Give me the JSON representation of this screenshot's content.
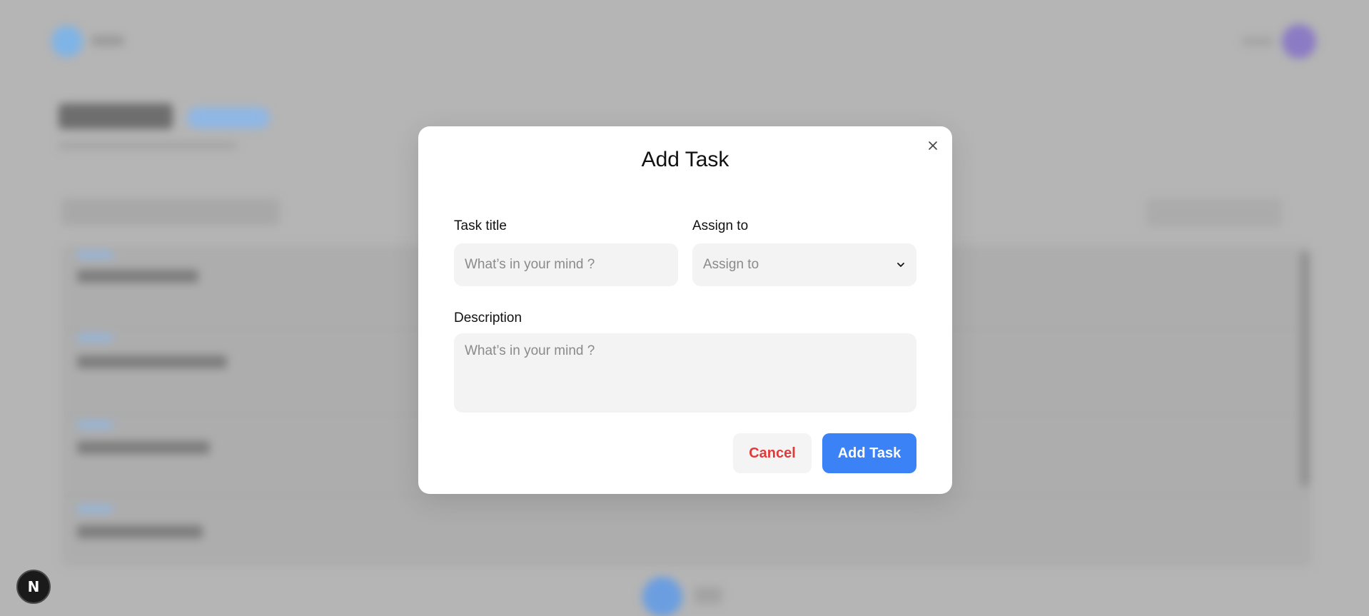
{
  "modal": {
    "title": "Add Task",
    "task_title": {
      "label": "Task title",
      "value": "",
      "placeholder": "What’s in your mind ?"
    },
    "assign_to": {
      "label": "Assign to",
      "selected": "Assign to",
      "icon": "chevron-down-icon"
    },
    "description": {
      "label": "Description",
      "value": "",
      "placeholder": "What’s in your mind ?"
    },
    "cancel_label": "Cancel",
    "submit_label": "Add Task",
    "close_icon": "close-icon"
  },
  "dev_indicator": {
    "label": "N"
  },
  "colors": {
    "primary": "#3b82f6",
    "danger": "#e03a3a",
    "overlay": "#b5b5b5"
  }
}
